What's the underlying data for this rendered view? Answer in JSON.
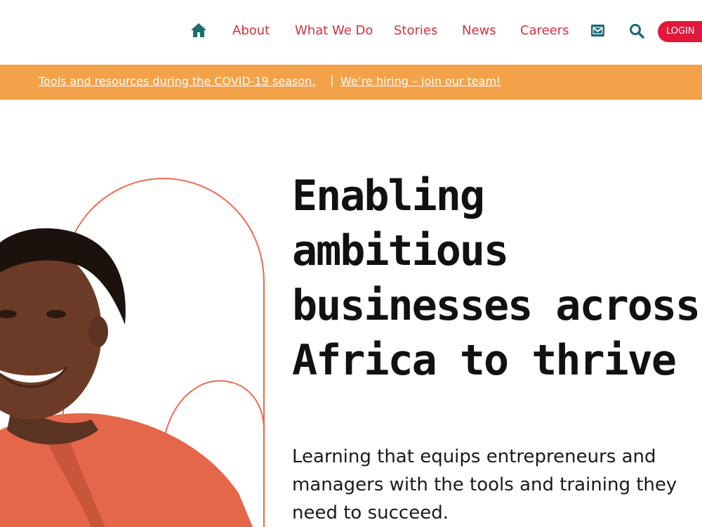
{
  "nav": {
    "home_icon": "home-icon",
    "links": [
      "About",
      "What We Do",
      "Stories",
      "News",
      "Careers"
    ],
    "mail_icon": "envelope-icon",
    "search_icon": "search-icon",
    "login": "LOGIN"
  },
  "banner": {
    "link1": "Tools and resources during the COVID-19 season.",
    "separator": "|",
    "link2": "We’re hiring – join our team!"
  },
  "hero": {
    "title_lines": [
      "Enabling",
      "ambitious",
      "businesses across",
      "Africa to thrive"
    ],
    "subtitle": "Learning that equips entrepreneurs and managers with the tools and training they need to succeed."
  },
  "colors": {
    "accent_red": "#d62f3f",
    "login_bg": "#e2173b",
    "nav_icon_teal": "#1a6b73",
    "banner_bg": "#f4a24a",
    "arch_stroke": "#ef6a4f"
  }
}
